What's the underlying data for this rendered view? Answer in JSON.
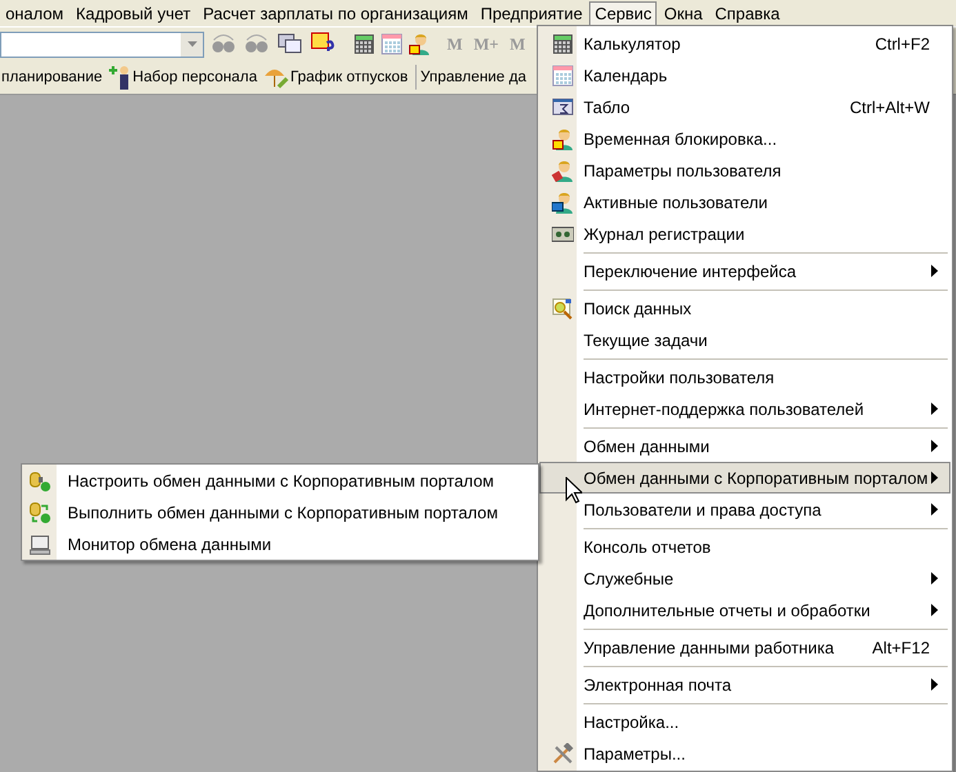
{
  "menubar": [
    {
      "label": "оналом",
      "selected": false
    },
    {
      "label": "Кадровый учет",
      "selected": false
    },
    {
      "label": "Расчет зарплаты по организациям",
      "selected": false
    },
    {
      "label": "Предприятие",
      "selected": false
    },
    {
      "label": "Сервис",
      "selected": true
    },
    {
      "label": "Окна",
      "selected": false
    },
    {
      "label": "Справка",
      "selected": false
    }
  ],
  "toolbar": {
    "memory_buttons": [
      "M",
      "M+",
      "M"
    ]
  },
  "panel_buttons": [
    "планирование",
    "Набор персонала",
    "График отпусков",
    "Управление да"
  ],
  "menu": {
    "items": [
      {
        "kind": "item",
        "label": "Калькулятор",
        "shortcut": "Ctrl+F2",
        "submenu": false,
        "selected": false
      },
      {
        "kind": "item",
        "label": "Календарь",
        "submenu": false,
        "selected": false
      },
      {
        "kind": "item",
        "label": "Табло",
        "shortcut": "Ctrl+Alt+W",
        "submenu": false,
        "selected": false
      },
      {
        "kind": "item",
        "label": "Временная блокировка...",
        "submenu": false,
        "selected": false
      },
      {
        "kind": "item",
        "label": "Параметры пользователя",
        "submenu": false,
        "selected": false
      },
      {
        "kind": "item",
        "label": "Активные пользователи",
        "submenu": false,
        "selected": false
      },
      {
        "kind": "item",
        "label": "Журнал регистрации",
        "submenu": false,
        "selected": false
      },
      {
        "kind": "separator"
      },
      {
        "kind": "item",
        "label": "Переключение интерфейса",
        "submenu": true,
        "selected": false
      },
      {
        "kind": "separator"
      },
      {
        "kind": "item",
        "label": "Поиск данных",
        "submenu": false,
        "selected": false
      },
      {
        "kind": "item",
        "label": "Текущие задачи",
        "submenu": false,
        "selected": false
      },
      {
        "kind": "separator"
      },
      {
        "kind": "item",
        "label": "Настройки пользователя",
        "submenu": false,
        "selected": false
      },
      {
        "kind": "item",
        "label": "Интернет-поддержка пользователей",
        "submenu": true,
        "selected": false
      },
      {
        "kind": "separator"
      },
      {
        "kind": "item",
        "label": "Обмен данными",
        "submenu": true,
        "selected": false
      },
      {
        "kind": "item",
        "label": "Обмен данными с Корпоративным порталом",
        "submenu": true,
        "selected": true
      },
      {
        "kind": "item",
        "label": "Пользователи и права доступа",
        "submenu": true,
        "selected": false
      },
      {
        "kind": "separator"
      },
      {
        "kind": "item",
        "label": "Консоль отчетов",
        "submenu": false,
        "selected": false
      },
      {
        "kind": "item",
        "label": "Служебные",
        "submenu": true,
        "selected": false
      },
      {
        "kind": "item",
        "label": "Дополнительные отчеты и обработки",
        "submenu": true,
        "selected": false
      },
      {
        "kind": "separator"
      },
      {
        "kind": "item",
        "label": "Управление данными работника",
        "shortcut": "Alt+F12",
        "submenu": false,
        "selected": false
      },
      {
        "kind": "separator"
      },
      {
        "kind": "item",
        "label": "Электронная почта",
        "submenu": true,
        "selected": false
      },
      {
        "kind": "separator"
      },
      {
        "kind": "item",
        "label": "Настройка...",
        "submenu": false,
        "selected": false
      },
      {
        "kind": "item",
        "label": "Параметры...",
        "submenu": false,
        "selected": false
      }
    ]
  },
  "submenu": {
    "items": [
      {
        "label": "Настроить обмен данными с Корпоративным порталом"
      },
      {
        "label": "Выполнить обмен данными с Корпоративным порталом"
      },
      {
        "label": "Монитор обмена данными"
      }
    ]
  }
}
